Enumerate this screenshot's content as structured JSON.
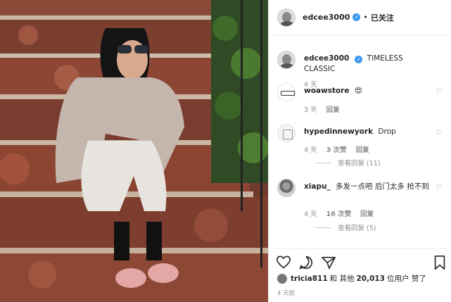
{
  "header": {
    "username": "edcee3000",
    "follow_status": "已关注",
    "separator": "•"
  },
  "caption": {
    "username": "edcee3000",
    "text": "TIMELESS CLASSIC",
    "time": "4 天"
  },
  "comments": [
    {
      "username": "woawstore",
      "text": "😍",
      "time": "3 天",
      "likes": "",
      "reply": "回复",
      "view_replies": ""
    },
    {
      "username": "hypedinnewyork",
      "text": "Drop",
      "time": "4 天",
      "likes": "3 次赞",
      "reply": "回复",
      "view_replies": "查看回复 (11)"
    },
    {
      "username": "xiapu_",
      "text": "多发一点吧 后门太多 抢不到",
      "time": "4 天",
      "likes": "16 次赞",
      "reply": "回复",
      "view_replies": "查看回复 (5)"
    }
  ],
  "likes_line": {
    "user": "tricia811",
    "middle": "和 其他",
    "count": "20,013",
    "suffix": "位用户 赞了"
  },
  "post_time": "4 天前",
  "icons": {
    "verified": "verified-badge-icon",
    "like": "heart-icon",
    "comment": "comment-icon",
    "share": "paper-plane-icon",
    "save": "bookmark-icon"
  },
  "colors": {
    "verified": "#3897f0",
    "muted": "#8e8e8e",
    "border": "#efefef"
  }
}
